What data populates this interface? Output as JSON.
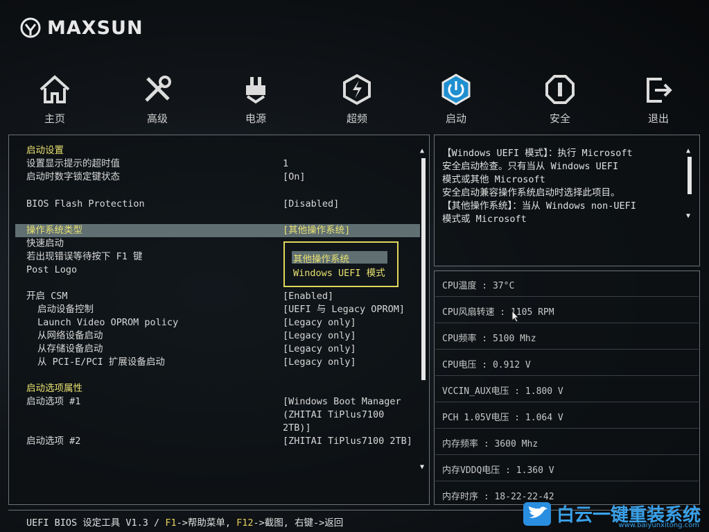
{
  "brand": {
    "name": "MAXSUN"
  },
  "nav": [
    {
      "label": "主页",
      "icon": "home-icon"
    },
    {
      "label": "高级",
      "icon": "tools-icon"
    },
    {
      "label": "电源",
      "icon": "power-plug-icon"
    },
    {
      "label": "超频",
      "icon": "lightning-icon"
    },
    {
      "label": "启动",
      "icon": "power-button-icon"
    },
    {
      "label": "安全",
      "icon": "shield-icon"
    },
    {
      "label": "退出",
      "icon": "exit-icon"
    }
  ],
  "active_tab": "启动",
  "settings": {
    "section_boot": "启动设置",
    "timeout_label": "设置显示提示的超时值",
    "timeout_value": "1",
    "numlock_label": "启动时数字锁定键状态",
    "numlock_value": "[On]",
    "flash_label": "BIOS Flash Protection",
    "flash_value": "[Disabled]",
    "ostype_label": "操作系统类型",
    "ostype_value": "[其他操作系统]",
    "fastboot_label": "快速启动",
    "f1_label": "若出现错误等待按下 F1 键",
    "postlogo_label": "Post Logo",
    "csm_label": "开启 CSM",
    "csm_value": "[Enabled]",
    "bootctrl_label": "启动设备控制",
    "bootctrl_value": "[UEFI 与 Legacy OPROM]",
    "video_label": "Launch Video OPROM policy",
    "video_value": "[Legacy only]",
    "network_label": "从网络设备启动",
    "network_value": "[Legacy only]",
    "storage_label": "从存储设备启动",
    "storage_value": "[Legacy only]",
    "pcie_label": "从 PCI-E/PCI 扩展设备启动",
    "pcie_value": "[Legacy only]",
    "section_prio": "启动选项属性",
    "boot1_label": "启动选项 #1",
    "boot1_value_l1": "[Windows Boot Manager",
    "boot1_value_l2": "(ZHITAI TiPlus7100",
    "boot1_value_l3": "2TB)]",
    "boot2_label": "启动选项 #2",
    "boot2_value": "[ZHITAI TiPlus7100 2TB]"
  },
  "popup": {
    "options": [
      "其他操作系统",
      "Windows UEFI 模式"
    ],
    "selected": "其他操作系统"
  },
  "help": {
    "lines": [
      "【Windows UEFI 模式】：执行 Microsoft",
      "安全启动检查。只有当从 Windows UEFI",
      "模式或其他 Microsoft",
      "安全启动兼容操作系统启动时选择此项目。",
      "【其他操作系统】：当从 Windows non-UEFI",
      "模式或 Microsoft"
    ]
  },
  "status": [
    {
      "label": "CPU温度 : 37°C"
    },
    {
      "label": "CPU风扇转速 : 1105 RPM"
    },
    {
      "label": "CPU频率 : 5100 Mhz"
    },
    {
      "label": "CPU电压 : 0.912 V"
    },
    {
      "label": "VCCIN_AUX电压 : 1.800 V"
    },
    {
      "label": "PCH 1.05V电压 : 1.064 V"
    },
    {
      "label": "内存频率 : 3600 Mhz"
    },
    {
      "label": "内存VDDQ电压 : 1.360 V"
    },
    {
      "label": "内存时序 : 18-22-22-42"
    }
  ],
  "footer": {
    "prefix": "UEFI BIOS 设定工具 V1.3 / ",
    "f1_key": "F1",
    "f1_text": "->帮助菜单, ",
    "f12_key": "F12",
    "f12_text": "->截图, 右键->返回"
  },
  "watermark": {
    "text": "白云一键重装系统",
    "sub": "www.baiyunxitong.com"
  },
  "colors": {
    "accent": "#e8e070",
    "highlight": "#5f6f72",
    "watermark": "#3aa0e8"
  }
}
